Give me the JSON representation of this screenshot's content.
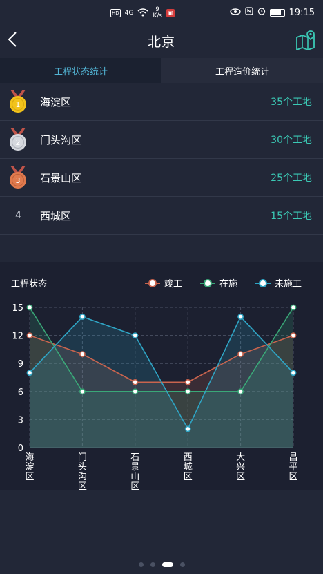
{
  "status_bar": {
    "hd": "HD",
    "signal": "4G",
    "speed_value": "9",
    "speed_unit": "K/s",
    "time": "19:15"
  },
  "header": {
    "title": "北京"
  },
  "tabs": [
    {
      "label": "工程状态统计",
      "active": true
    },
    {
      "label": "工程造价统计",
      "active": false
    }
  ],
  "ranking": [
    {
      "rank": "1",
      "district": "海淀区",
      "count": "35个工地",
      "medal": "gold"
    },
    {
      "rank": "2",
      "district": "门头沟区",
      "count": "30个工地",
      "medal": "silver"
    },
    {
      "rank": "3",
      "district": "石景山区",
      "count": "25个工地",
      "medal": "bronze"
    },
    {
      "rank": "4",
      "district": "西城区",
      "count": "15个工地",
      "medal": "none"
    }
  ],
  "chart_data": {
    "type": "area",
    "title": "工程状态",
    "categories": [
      "海淀区",
      "门头沟区",
      "石景山区",
      "西城区",
      "大兴区",
      "昌平区"
    ],
    "series": [
      {
        "name": "竣工",
        "color": "#c9644e",
        "values": [
          12,
          10,
          7,
          7,
          10,
          12
        ]
      },
      {
        "name": "在施",
        "color": "#3aa878",
        "values": [
          15,
          6,
          6,
          6,
          6,
          15
        ]
      },
      {
        "name": "未施工",
        "color": "#2fa5c5",
        "values": [
          8,
          14,
          12,
          2,
          14,
          8
        ]
      }
    ],
    "yticks": [
      0,
      3,
      6,
      9,
      12,
      15
    ],
    "ylim": [
      0,
      15
    ],
    "grid": true,
    "legend_position": "top-right"
  },
  "pager": {
    "count": 4,
    "active": 2
  }
}
